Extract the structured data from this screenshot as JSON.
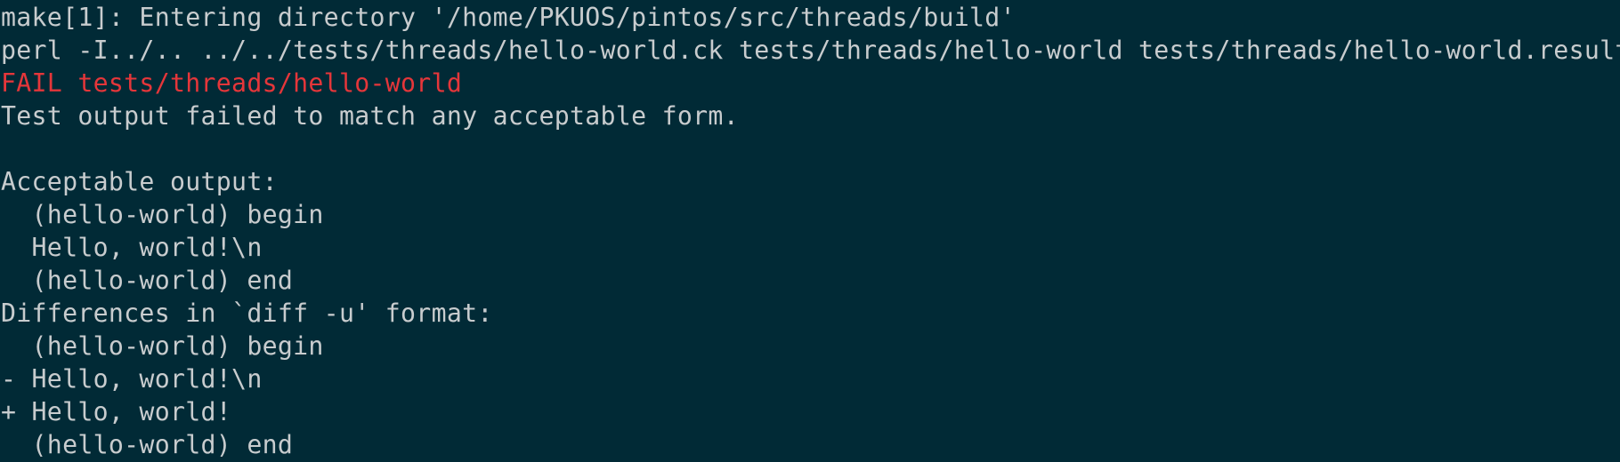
{
  "colors": {
    "background": "#012a36",
    "foreground": "#c8ccce",
    "fail": "#e5363a"
  },
  "terminal": {
    "lines": [
      "make[1]: Entering directory '/home/PKUOS/pintos/src/threads/build'",
      "perl -I../.. ../../tests/threads/hello-world.ck tests/threads/hello-world tests/threads/hello-world.result",
      "FAIL tests/threads/hello-world",
      "Test output failed to match any acceptable form.",
      "",
      "Acceptable output:",
      "  (hello-world) begin",
      "  Hello, world!\\n",
      "  (hello-world) end",
      "Differences in `diff -u' format:",
      "  (hello-world) begin",
      "- Hello, world!\\n",
      "+ Hello, world!",
      "  (hello-world) end"
    ]
  }
}
